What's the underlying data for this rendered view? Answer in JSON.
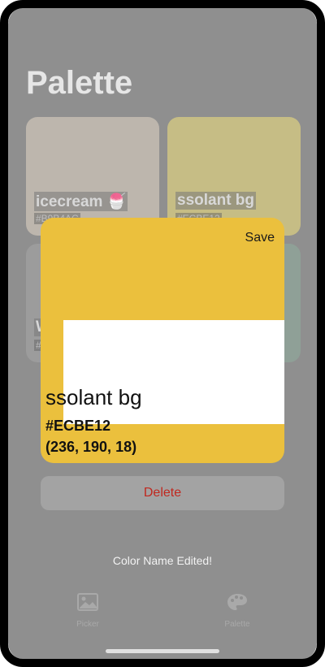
{
  "header": {
    "title": "Palette"
  },
  "grid": {
    "tiles": [
      {
        "name": "icecream 🍧",
        "hex": "#B9B4AC"
      },
      {
        "name": "ssolant bg",
        "hex": "#ECBE12"
      },
      {
        "name": "W",
        "hex": "#"
      },
      {
        "name": "",
        "hex": ""
      }
    ]
  },
  "editor": {
    "save_label": "Save",
    "name": "ssolant bg",
    "hex": "#ECBE12",
    "rgb": "(236, 190, 18)",
    "swatch_color": "#EBC03D"
  },
  "delete_label": "Delete",
  "toast": "Color Name Edited!",
  "tabs": [
    {
      "label": "Picker",
      "icon": "image-icon"
    },
    {
      "label": "Palette",
      "icon": "palette-icon"
    }
  ]
}
